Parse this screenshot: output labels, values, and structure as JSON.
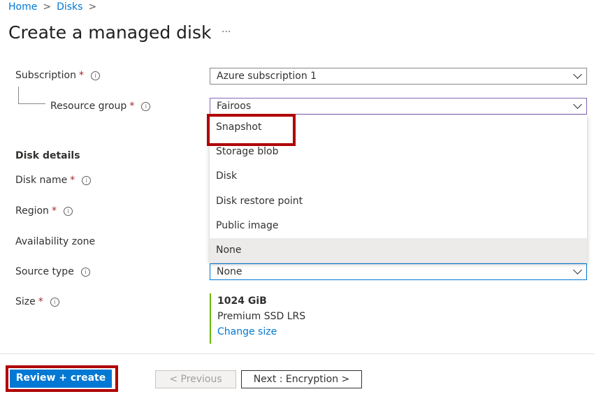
{
  "breadcrumb": [
    "Home",
    "Disks"
  ],
  "title": "Create a managed disk",
  "more": "···",
  "form": {
    "subscription": {
      "label": "Subscription",
      "value": "Azure subscription 1"
    },
    "resource_group": {
      "label": "Resource group",
      "value": "Fairoos"
    },
    "section": "Disk details",
    "disk_name": {
      "label": "Disk name"
    },
    "region": {
      "label": "Region"
    },
    "availability_zone": {
      "label": "Availability zone"
    },
    "source_type": {
      "label": "Source type",
      "value": "None",
      "options": [
        "Snapshot",
        "Storage blob",
        "Disk",
        "Disk restore point",
        "Public image",
        "None"
      ]
    },
    "size": {
      "label": "Size",
      "value": "1024 GiB",
      "sku": "Premium SSD LRS",
      "change": "Change size"
    }
  },
  "footer": {
    "review": "Review + create",
    "previous": "< Previous",
    "next": "Next : Encryption >"
  },
  "colors": {
    "accent": "#0078d4",
    "highlight": "#b00000",
    "size_bar": "#6bb700"
  }
}
